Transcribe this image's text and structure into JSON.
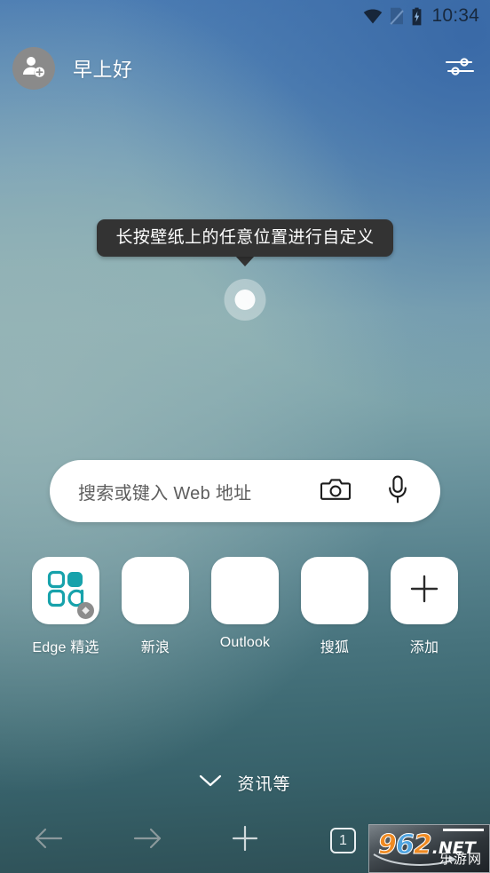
{
  "status_bar": {
    "time": "10:34",
    "icons": [
      "wifi-icon",
      "sim-off-icon",
      "battery-charging-icon"
    ]
  },
  "header": {
    "greeting": "早上好",
    "avatar_icon": "person-add-icon",
    "settings_icon": "tune-icon"
  },
  "tooltip": {
    "text": "长按壁纸上的任意位置进行自定义"
  },
  "ripple": {
    "icon": "touch-ripple-indicator"
  },
  "search": {
    "placeholder": "搜索或键入 Web 地址",
    "camera_icon": "camera-icon",
    "mic_icon": "microphone-icon"
  },
  "tiles": [
    {
      "label": "Edge 精选",
      "icon": "edge-collections-grid-icon",
      "badge": "diamond-badge-icon"
    },
    {
      "label": "新浪",
      "icon": "blank-tile-icon",
      "badge": ""
    },
    {
      "label": "Outlook",
      "icon": "blank-tile-icon",
      "badge": ""
    },
    {
      "label": "搜狐",
      "icon": "blank-tile-icon",
      "badge": ""
    },
    {
      "label": "添加",
      "icon": "plus-icon",
      "badge": ""
    }
  ],
  "feed": {
    "label": "资讯等",
    "icon": "chevron-down-icon"
  },
  "bottom_nav": {
    "back_icon": "arrow-left-icon",
    "forward_icon": "arrow-right-icon",
    "new_tab_icon": "plus-icon",
    "tab_count": "1"
  },
  "watermark": {
    "digit_9": "9",
    "digit_6": "6",
    "digit_2": "2",
    "net": ".NET",
    "chinese": "乐游网"
  },
  "colors": {
    "edge_teal": "#17a2ab",
    "tooltip_bg": "#333333",
    "tile_white": "#ffffff",
    "wm_orange": "#ef8a22",
    "wm_blue": "#4ea3e0"
  }
}
